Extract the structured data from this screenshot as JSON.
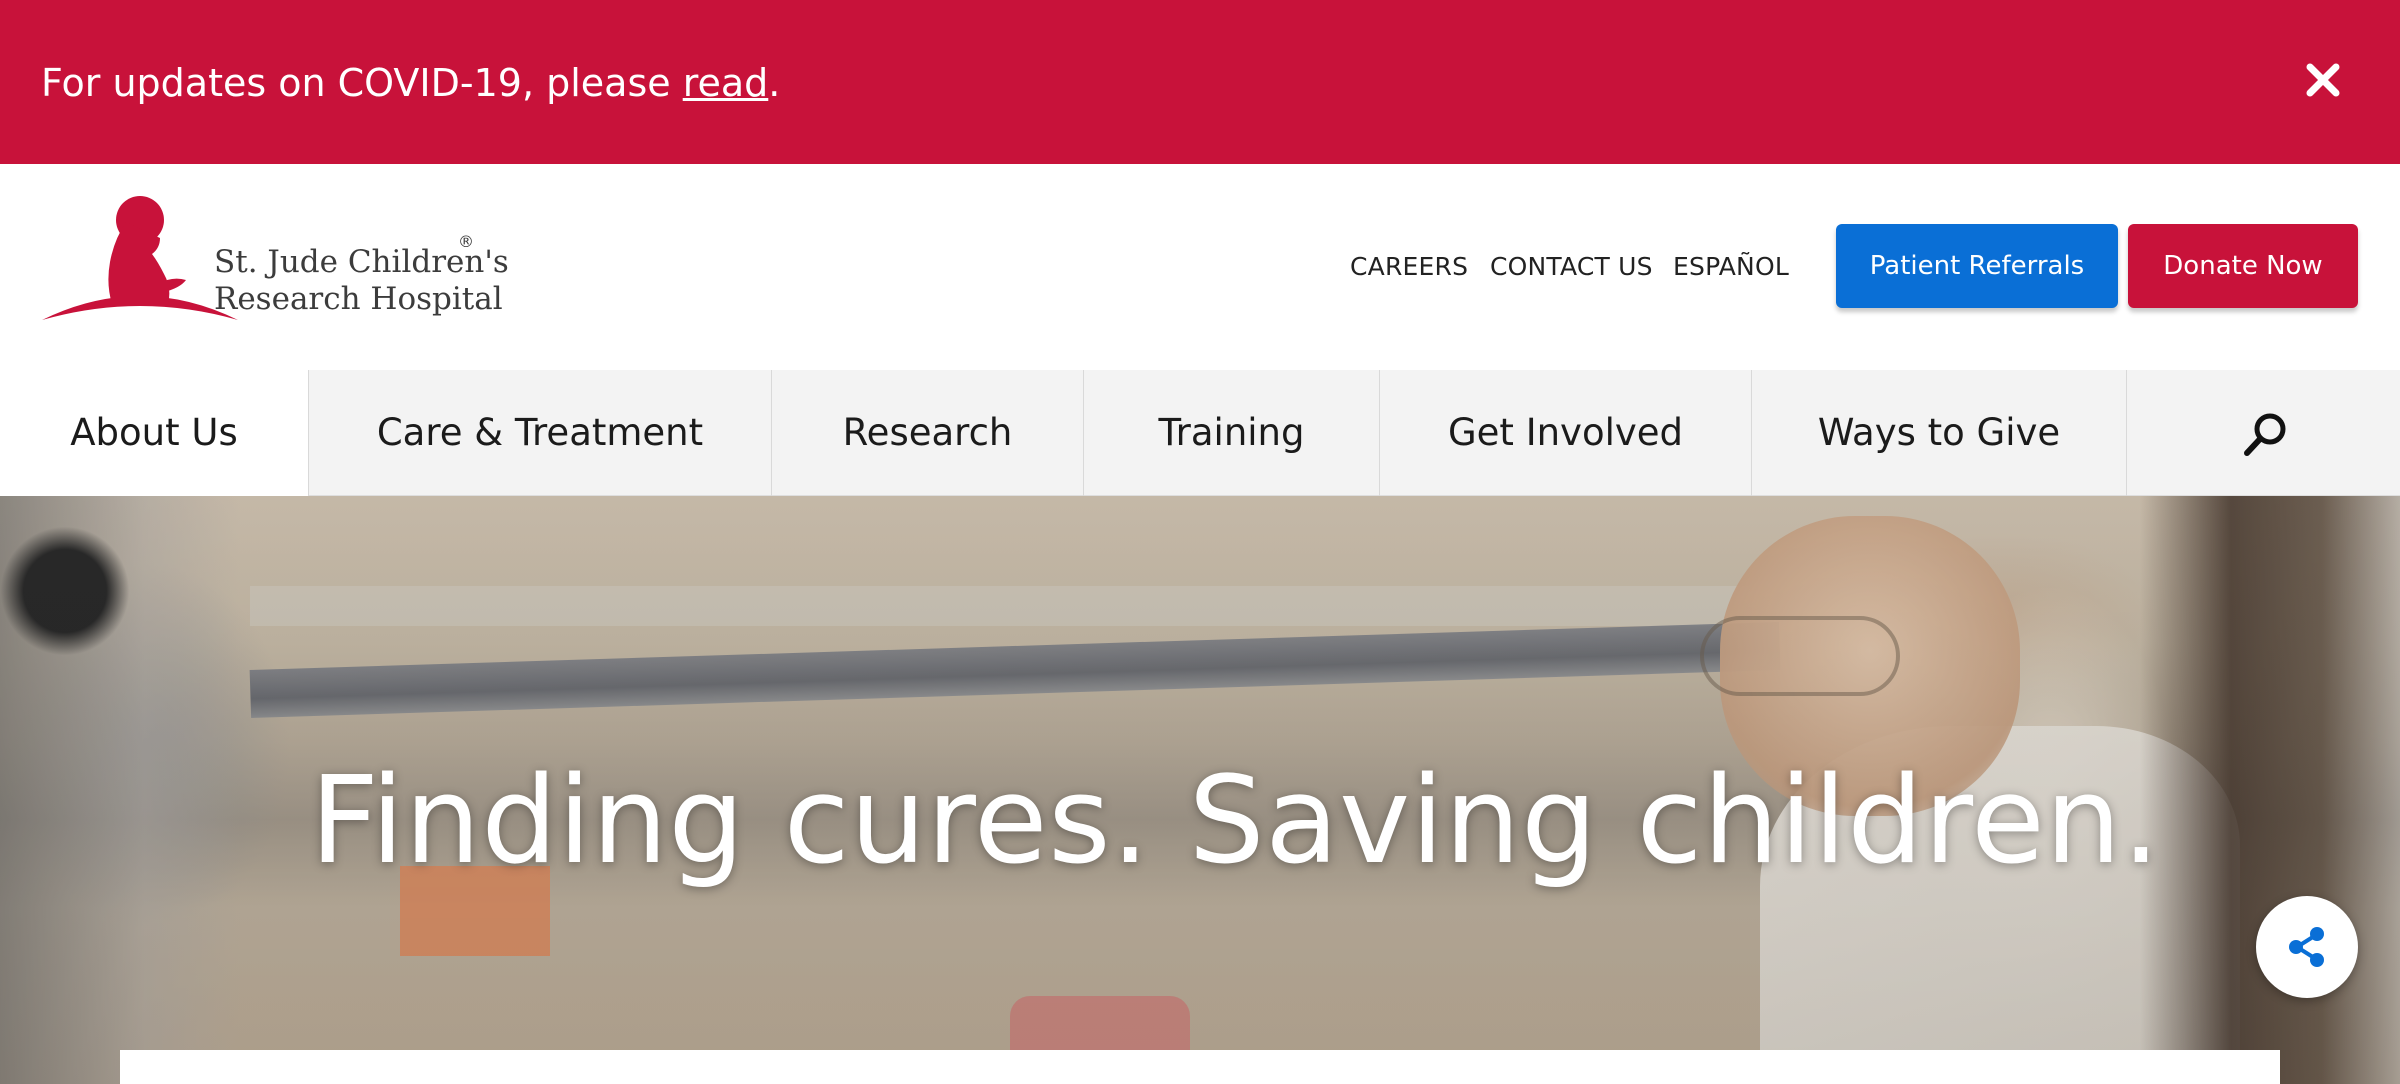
{
  "alert": {
    "text_before": "For updates on COVID-19, please ",
    "link_text": "read",
    "text_after": ".",
    "close_icon": "close-icon",
    "background": "#c8123a"
  },
  "header": {
    "logo": {
      "line1": "St. Jude Children's",
      "line2": "Research Hospital",
      "registered_mark": "®",
      "color": "#c8123a"
    },
    "utility_links": {
      "careers": "CAREERS",
      "contact": "CONTACT US",
      "espanol": "ESPAÑOL"
    },
    "buttons": {
      "patient_referrals": "Patient Referrals",
      "donate_now": "Donate Now",
      "referrals_color": "#0a6fd6",
      "donate_color": "#c8123a"
    }
  },
  "nav": {
    "items": [
      {
        "label": "About Us"
      },
      {
        "label": "Care & Treatment"
      },
      {
        "label": "Research"
      },
      {
        "label": "Training"
      },
      {
        "label": "Get Involved"
      },
      {
        "label": "Ways to Give"
      }
    ],
    "search_icon": "search-icon"
  },
  "hero": {
    "title": "Finding cures. Saving children.",
    "share_icon": "share-icon",
    "share_color": "#0a6fd6"
  }
}
